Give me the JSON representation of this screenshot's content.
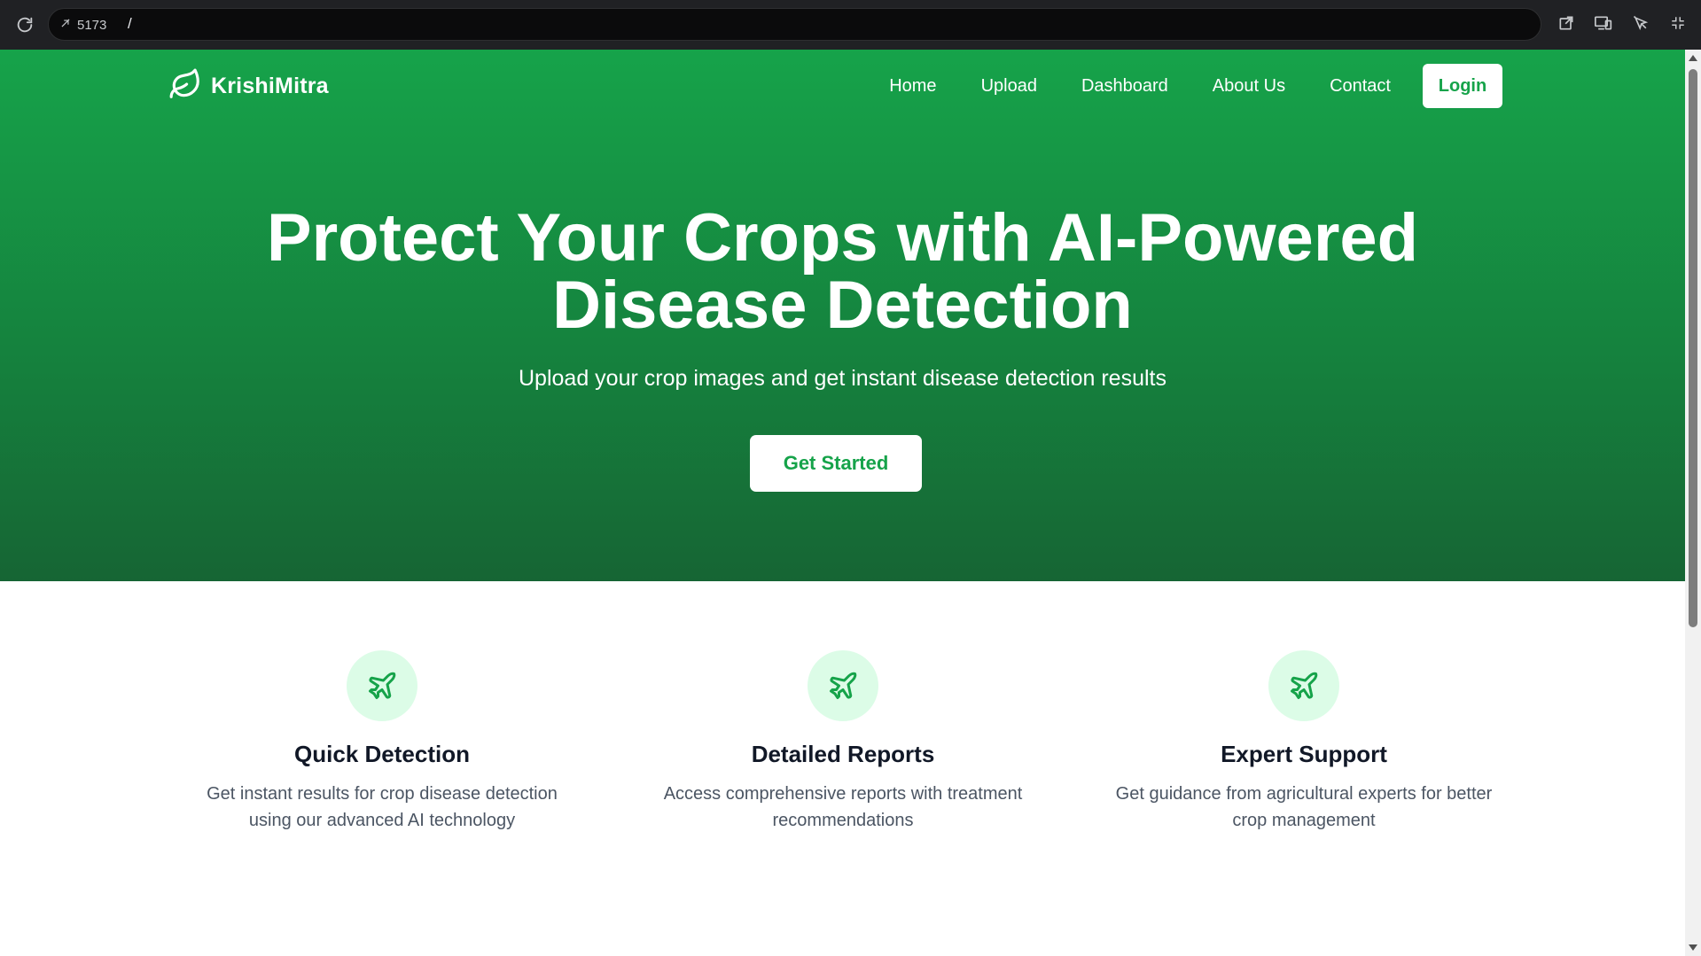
{
  "browser": {
    "port": "5173",
    "path": "/",
    "icons": [
      "reload-icon",
      "open-external-icon",
      "devices-icon",
      "inspect-icon",
      "collapse-icon"
    ]
  },
  "nav": {
    "brand": "KrishiMitra",
    "links": [
      "Home",
      "Upload",
      "Dashboard",
      "About Us",
      "Contact"
    ],
    "login": "Login"
  },
  "hero": {
    "title_line1": "Protect Your Crops with AI-Powered",
    "title_line2": "Disease Detection",
    "subtitle": "Upload your crop images and get instant disease detection results",
    "cta": "Get Started"
  },
  "features": [
    {
      "icon": "plane-icon",
      "title": "Quick Detection",
      "description": "Get instant results for crop disease detection using our advanced AI technology"
    },
    {
      "icon": "plane-icon",
      "title": "Detailed Reports",
      "description": "Access comprehensive reports with treatment recommendations"
    },
    {
      "icon": "plane-icon",
      "title": "Expert Support",
      "description": "Get guidance from agricultural experts for better crop management"
    }
  ],
  "colors": {
    "primary": "#16a34a",
    "hero_gradient_end": "#166534",
    "feature_icon_bg": "#dcfce7"
  }
}
